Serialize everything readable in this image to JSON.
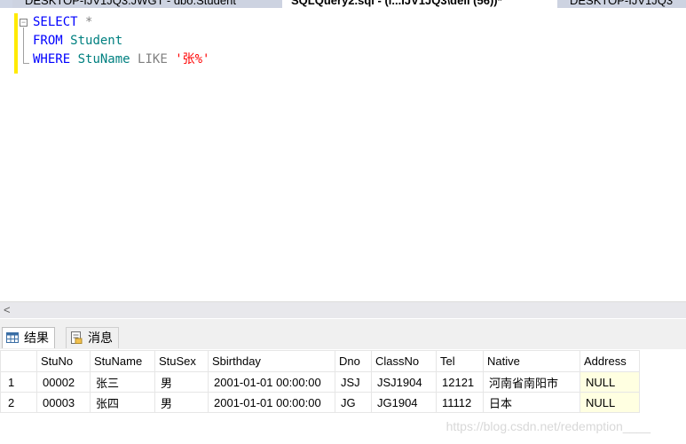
{
  "tabs": [
    {
      "label": "DESKTOP-IJV1JQ3.JWGT - dbo.Student"
    },
    {
      "label": "SQLQuery2.sql - (l...IJV1JQ3\\dell (56))*"
    },
    {
      "label": "DESKTOP-IJV1JQ3"
    }
  ],
  "editor": {
    "line1": {
      "kw": "SELECT",
      "rest": " *"
    },
    "line2": {
      "kw": "FROM",
      "id": "Student"
    },
    "line3": {
      "kw": "WHERE",
      "id": "StuName",
      "op": "LIKE",
      "str": "'张%'"
    },
    "fold": "−"
  },
  "scroll": {
    "left_arrow": "<"
  },
  "results_tabs": [
    {
      "label": "结果",
      "icon": "grid-icon"
    },
    {
      "label": "消息",
      "icon": "message-icon"
    }
  ],
  "results": {
    "columns": [
      "StuNo",
      "StuName",
      "StuSex",
      "Sbirthday",
      "Dno",
      "ClassNo",
      "Tel",
      "Native",
      "Address"
    ],
    "rows": [
      {
        "n": "1",
        "cells": [
          "00002",
          "张三",
          "男",
          "2001-01-01 00:00:00",
          "JSJ",
          "JSJ1904",
          "12121",
          "河南省南阳市",
          "NULL"
        ]
      },
      {
        "n": "2",
        "cells": [
          "00003",
          "张四",
          "男",
          "2001-01-01 00:00:00",
          "JG",
          "JG1904",
          "11112",
          "日本",
          "NULL"
        ]
      }
    ]
  },
  "watermark": "https://blog.csdn.net/redemption____",
  "colors": {
    "keyword": "#0000ff",
    "identifier": "#008080",
    "string": "#ff0000",
    "null_bg": "#ffffe1"
  }
}
